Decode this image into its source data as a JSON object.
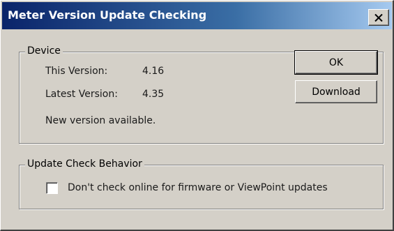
{
  "window": {
    "title": "Meter Version Update Checking",
    "close_label": "close"
  },
  "device": {
    "legend": "Device",
    "this_version_label": "This Version:",
    "this_version_value": "4.16",
    "latest_version_label": "Latest Version:",
    "latest_version_value": "4.35",
    "status": "New version available."
  },
  "buttons": {
    "ok": "OK",
    "download": "Download"
  },
  "update": {
    "legend": "Update Check Behavior",
    "checkbox_label": "Don't check online for firmware or ViewPoint updates",
    "checked": false
  },
  "colors": {
    "titlebar_start": "#0a246a",
    "titlebar_end": "#a6caf0",
    "dialog_bg": "#d4d0c8"
  },
  "icons": {
    "close": "close-icon"
  }
}
